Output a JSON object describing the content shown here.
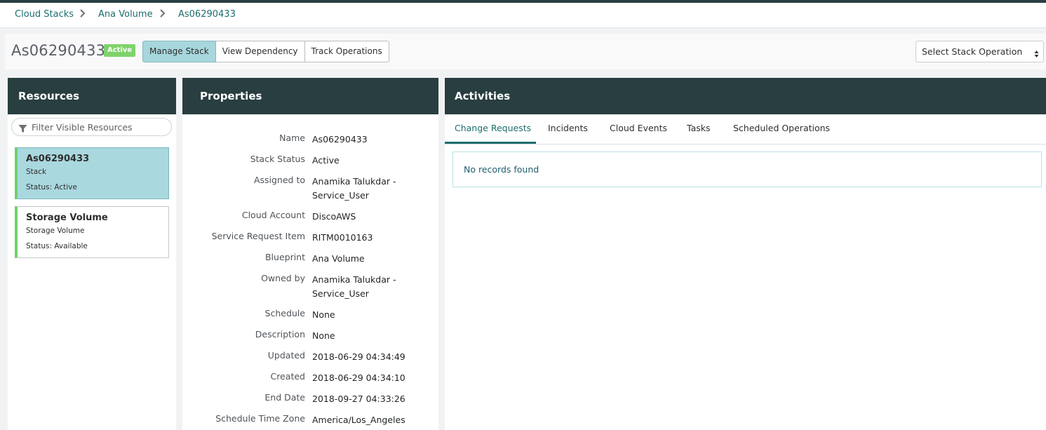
{
  "breadcrumb": {
    "items": [
      {
        "label": "Cloud Stacks"
      },
      {
        "label": "Ana Volume"
      },
      {
        "label": "As06290433"
      }
    ],
    "separator_icon": "chevron-right-icon"
  },
  "header": {
    "title": "As06290433",
    "status_badge": "Active",
    "buttons": [
      {
        "label": "Manage Stack",
        "selected": true
      },
      {
        "label": "View Dependency",
        "selected": false
      },
      {
        "label": "Track Operations",
        "selected": false
      }
    ],
    "stack_operation_select": {
      "selected": "Select Stack Operation",
      "icon": "up-down-caret-icon"
    }
  },
  "resources": {
    "title": "Resources",
    "filter": {
      "placeholder": "Filter Visible Resources",
      "value": "",
      "icon": "filter-icon"
    },
    "items": [
      {
        "name": "As06290433",
        "type": "Stack",
        "status": "Status: Active",
        "selected": true
      },
      {
        "name": "Storage Volume",
        "type": "Storage Volume",
        "status": "Status: Available",
        "selected": false
      }
    ]
  },
  "properties": {
    "title": "Properties",
    "rows": [
      {
        "label": "Name",
        "value": "As06290433"
      },
      {
        "label": "Stack Status",
        "value": "Active"
      },
      {
        "label": "Assigned to",
        "value": "Anamika Talukdar - Service_User"
      },
      {
        "label": "Cloud Account",
        "value": "DiscoAWS"
      },
      {
        "label": "Service Request Item",
        "value": "RITM0010163"
      },
      {
        "label": "Blueprint",
        "value": "Ana Volume"
      },
      {
        "label": "Owned by",
        "value": "Anamika Talukdar - Service_User"
      },
      {
        "label": "Schedule",
        "value": "None"
      },
      {
        "label": "Description",
        "value": "None"
      },
      {
        "label": "Updated",
        "value": "2018-06-29 04:34:49"
      },
      {
        "label": "Created",
        "value": "2018-06-29 04:34:10"
      },
      {
        "label": "End Date",
        "value": "2018-09-27 04:33:26"
      },
      {
        "label": "Schedule Time Zone",
        "value": "America/Los_Angeles"
      }
    ]
  },
  "activities": {
    "title": "Activities",
    "tabs": [
      {
        "label": "Change Requests",
        "active": true
      },
      {
        "label": "Incidents",
        "active": false
      },
      {
        "label": "Cloud Events",
        "active": false
      },
      {
        "label": "Tasks",
        "active": false
      },
      {
        "label": "Scheduled Operations",
        "active": false
      }
    ],
    "empty_message": "No records found"
  },
  "colors": {
    "header_dark": "#293e40",
    "accent_teal": "#1d6d6d",
    "status_green": "#7fd36b",
    "selected_blue": "#aad8df"
  }
}
